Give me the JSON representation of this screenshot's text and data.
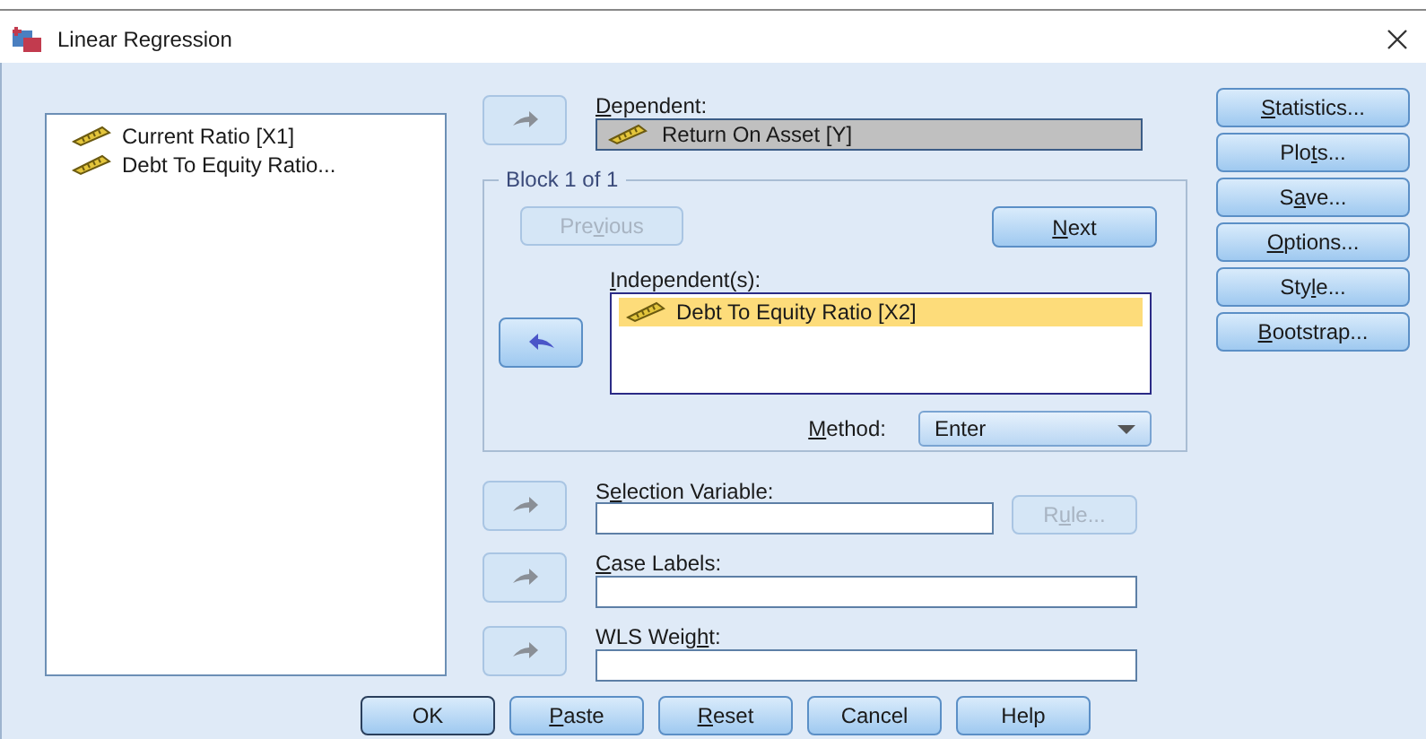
{
  "window": {
    "title": "Linear Regression"
  },
  "variables": [
    {
      "name": "Current Ratio [X1]"
    },
    {
      "name": "Debt To Equity Ratio..."
    }
  ],
  "dependent": {
    "arrow": {
      "kind": "right",
      "disabled": true
    },
    "label": {
      "key": "D",
      "rest": "ependent:"
    },
    "value": "Return On Asset [Y]"
  },
  "block": {
    "title": "Block 1 of 1",
    "previous": {
      "label": {
        "pre": "Pre",
        "key": "v",
        "rest": "ious"
      },
      "disabled": true
    },
    "next": {
      "label": {
        "key": "N",
        "rest": "ext"
      },
      "disabled": false
    },
    "arrow": {
      "kind": "left",
      "disabled": false
    },
    "independents_label": {
      "key": "I",
      "rest": "ndependent(s):"
    },
    "independents": [
      {
        "name": "Debt To Equity Ratio [X2]",
        "selected": true
      }
    ],
    "method_label": {
      "key": "M",
      "rest": "ethod:"
    },
    "method": "Enter"
  },
  "selection": {
    "arrow": {
      "kind": "right",
      "disabled": true
    },
    "label": {
      "pre": "S",
      "key": "e",
      "rest": "lection Variable:"
    },
    "rule": {
      "label": {
        "pre": "R",
        "key": "u",
        "rest": "le..."
      },
      "disabled": true
    }
  },
  "case_labels": {
    "arrow": {
      "kind": "right",
      "disabled": true
    },
    "label": {
      "key": "C",
      "rest": "ase Labels:"
    }
  },
  "wls_weight": {
    "arrow": {
      "kind": "right",
      "disabled": true
    },
    "label": {
      "pre": "WLS Weig",
      "key": "h",
      "rest": "t:"
    }
  },
  "side_buttons": [
    {
      "label": {
        "key": "S",
        "rest": "tatistics..."
      }
    },
    {
      "label": {
        "pre": "Plo",
        "key": "t",
        "rest": "s..."
      }
    },
    {
      "label": {
        "pre": "S",
        "key": "a",
        "rest": "ve..."
      }
    },
    {
      "label": {
        "key": "O",
        "rest": "ptions..."
      }
    },
    {
      "label": {
        "pre": "Sty",
        "key": "l",
        "rest": "e..."
      }
    },
    {
      "label": {
        "key": "B",
        "rest": "ootstrap..."
      }
    }
  ],
  "footer_buttons": [
    {
      "label": {
        "rest": "OK"
      },
      "default": true
    },
    {
      "label": {
        "key": "P",
        "rest": "aste"
      },
      "default": false
    },
    {
      "label": {
        "key": "R",
        "rest": "eset"
      },
      "default": false
    },
    {
      "label": {
        "rest": "Cancel"
      },
      "default": false
    },
    {
      "label": {
        "rest": "Help"
      },
      "default": false
    }
  ]
}
